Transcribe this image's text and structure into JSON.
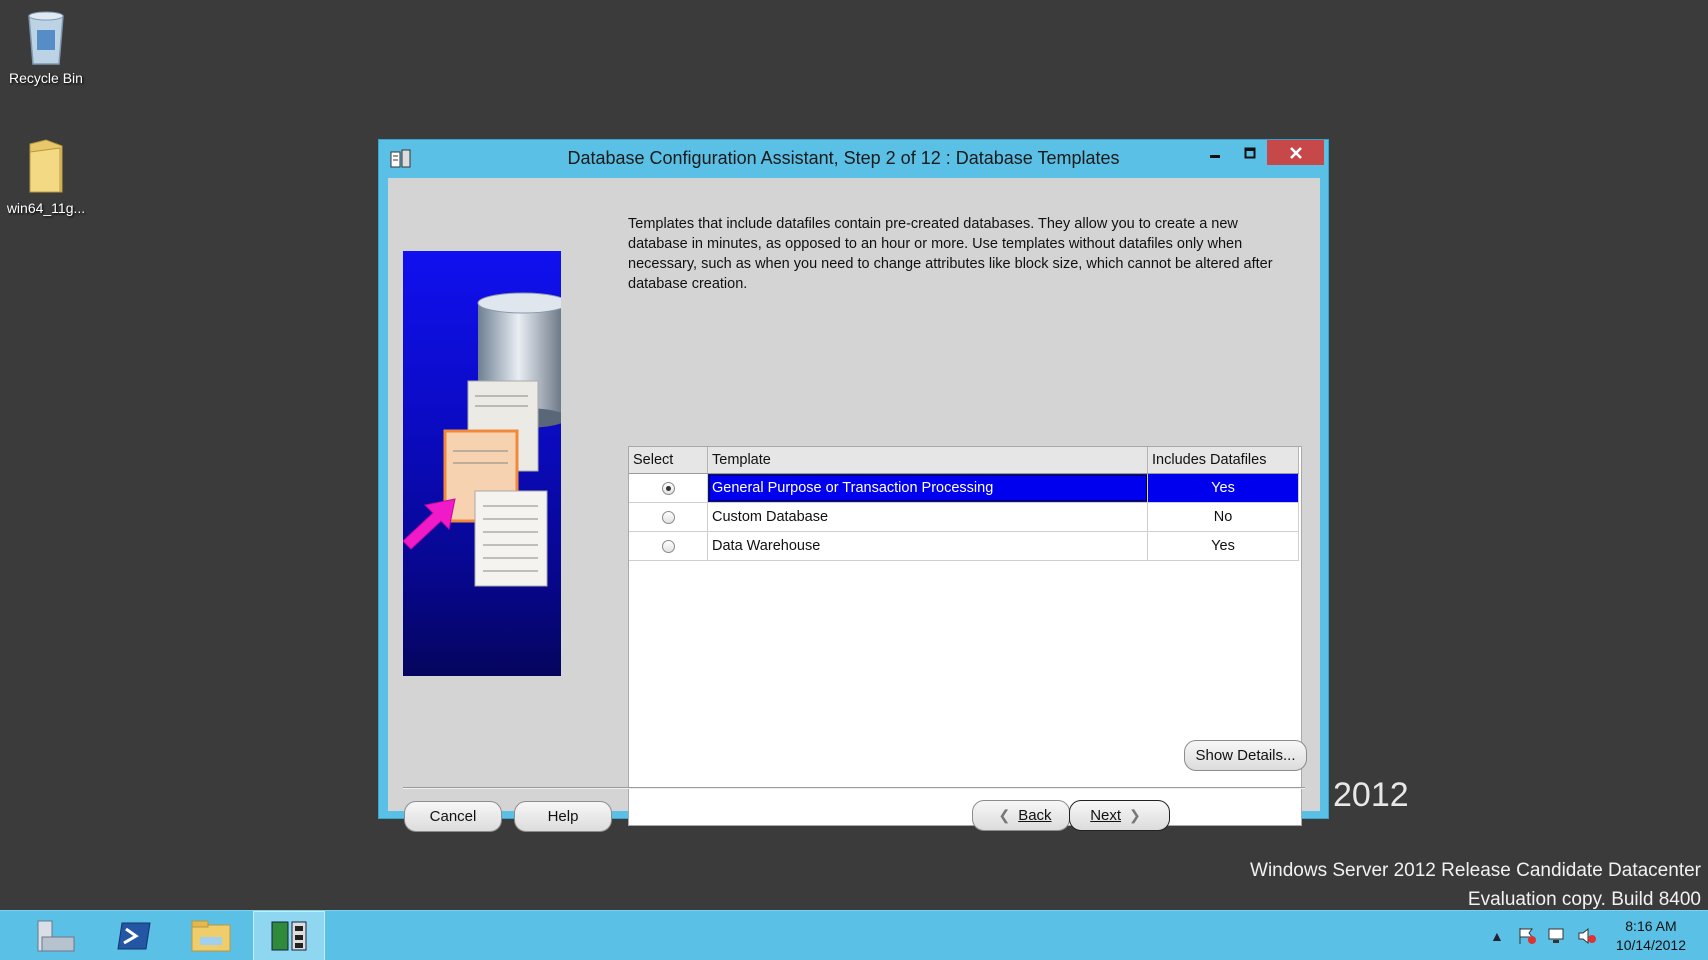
{
  "desktop": {
    "icons": [
      {
        "label": "Recycle Bin"
      },
      {
        "label": "win64_11g..."
      }
    ],
    "brand_year": "2012",
    "os_info_line1": "Windows Server 2012 Release Candidate Datacenter",
    "os_info_line2": "Evaluation copy. Build 8400"
  },
  "window": {
    "title": "Database Configuration Assistant, Step 2 of 12 : Database Templates",
    "controls": {
      "minimize": "minimize-icon",
      "maximize": "maximize-icon",
      "close": "close-icon"
    }
  },
  "dialog": {
    "description": "Templates that include datafiles contain pre-created databases. They allow you to create a new database in minutes, as opposed to an hour or more. Use templates without datafiles only when necessary, such as when you need to change attributes like block size, which cannot be altered after database creation.",
    "table": {
      "headers": {
        "select": "Select",
        "template": "Template",
        "includes_datafiles": "Includes Datafiles"
      },
      "rows": [
        {
          "selected": true,
          "template": "General Purpose or Transaction Processing",
          "includes_datafiles": "Yes"
        },
        {
          "selected": false,
          "template": "Custom Database",
          "includes_datafiles": "No"
        },
        {
          "selected": false,
          "template": "Data Warehouse",
          "includes_datafiles": "Yes"
        }
      ]
    },
    "buttons": {
      "show_details": "Show Details...",
      "cancel": "Cancel",
      "help": "Help",
      "back": "Back",
      "next": "Next"
    }
  },
  "taskbar": {
    "clock_time": "8:16 AM",
    "clock_date": "10/14/2012"
  },
  "colors": {
    "accent": "#5ac0e6",
    "selection": "#0000ee",
    "close_button": "#c74848"
  }
}
